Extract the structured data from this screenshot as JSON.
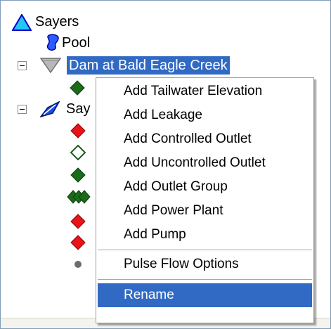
{
  "tree": {
    "root_label": "Sayers",
    "pool_label": "Pool",
    "dam_label": "Dam at Bald Eagle Creek",
    "sayers_truncated_label": "Say"
  },
  "context_menu": {
    "items": [
      "Add Tailwater Elevation",
      "Add Leakage",
      "Add Controlled Outlet",
      "Add Uncontrolled Outlet",
      "Add Outlet Group",
      "Add Power Plant",
      "Add Pump",
      "Pulse Flow Options",
      "Rename"
    ],
    "highlighted": "Rename"
  },
  "colors": {
    "selection": "#316ac5",
    "red_diamond": "#e8141a",
    "green_diamond": "#1a6b1a",
    "reservoir_blue": "#1a4fe0",
    "pool_blue": "#2a5cff"
  }
}
